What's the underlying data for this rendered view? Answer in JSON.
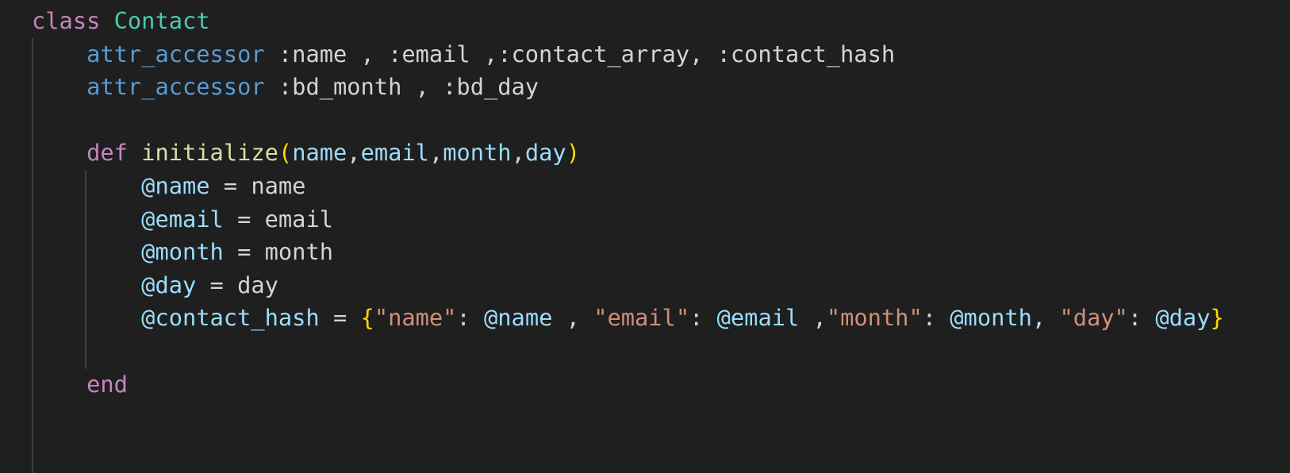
{
  "code_lines": [
    {
      "tokens": [
        {
          "t": "class",
          "c": "kw"
        },
        {
          "t": " ",
          "c": "plain"
        },
        {
          "t": "Contact",
          "c": "cls"
        }
      ]
    },
    {
      "tokens": [
        {
          "t": "    ",
          "c": "plain"
        },
        {
          "t": "attr_accessor",
          "c": "fn-blue"
        },
        {
          "t": " :name , :email ,:contact_array, :contact_hash",
          "c": "plain"
        }
      ]
    },
    {
      "tokens": [
        {
          "t": "    ",
          "c": "plain"
        },
        {
          "t": "attr_accessor",
          "c": "fn-blue"
        },
        {
          "t": " :bd_month , :bd_day",
          "c": "plain"
        }
      ]
    },
    {
      "tokens": []
    },
    {
      "tokens": [
        {
          "t": "    ",
          "c": "plain"
        },
        {
          "t": "def",
          "c": "kw"
        },
        {
          "t": " ",
          "c": "plain"
        },
        {
          "t": "initialize",
          "c": "fn-yellow"
        },
        {
          "t": "(",
          "c": "brace"
        },
        {
          "t": "name",
          "c": "var"
        },
        {
          "t": ",",
          "c": "plain"
        },
        {
          "t": "email",
          "c": "var"
        },
        {
          "t": ",",
          "c": "plain"
        },
        {
          "t": "month",
          "c": "var"
        },
        {
          "t": ",",
          "c": "plain"
        },
        {
          "t": "day",
          "c": "var"
        },
        {
          "t": ")",
          "c": "brace"
        }
      ]
    },
    {
      "tokens": [
        {
          "t": "        ",
          "c": "plain"
        },
        {
          "t": "@name",
          "c": "var"
        },
        {
          "t": " = name",
          "c": "plain"
        }
      ]
    },
    {
      "tokens": [
        {
          "t": "        ",
          "c": "plain"
        },
        {
          "t": "@email",
          "c": "var"
        },
        {
          "t": " = email",
          "c": "plain"
        }
      ]
    },
    {
      "tokens": [
        {
          "t": "        ",
          "c": "plain"
        },
        {
          "t": "@month",
          "c": "var"
        },
        {
          "t": " = month",
          "c": "plain"
        }
      ]
    },
    {
      "tokens": [
        {
          "t": "        ",
          "c": "plain"
        },
        {
          "t": "@day",
          "c": "var"
        },
        {
          "t": " = day",
          "c": "plain"
        }
      ]
    },
    {
      "tokens": [
        {
          "t": "        ",
          "c": "plain"
        },
        {
          "t": "@contact_hash",
          "c": "var"
        },
        {
          "t": " = ",
          "c": "plain"
        },
        {
          "t": "{",
          "c": "brace"
        },
        {
          "t": "\"name\"",
          "c": "str"
        },
        {
          "t": ": ",
          "c": "plain"
        },
        {
          "t": "@name",
          "c": "var"
        },
        {
          "t": " , ",
          "c": "plain"
        },
        {
          "t": "\"email\"",
          "c": "str"
        },
        {
          "t": ": ",
          "c": "plain"
        },
        {
          "t": "@email",
          "c": "var"
        },
        {
          "t": " ,",
          "c": "plain"
        },
        {
          "t": "\"month\"",
          "c": "str"
        },
        {
          "t": ": ",
          "c": "plain"
        },
        {
          "t": "@month",
          "c": "var"
        },
        {
          "t": ", ",
          "c": "plain"
        },
        {
          "t": "\"day\"",
          "c": "str"
        },
        {
          "t": ": ",
          "c": "plain"
        },
        {
          "t": "@day",
          "c": "var"
        },
        {
          "t": "}",
          "c": "brace"
        }
      ]
    },
    {
      "tokens": []
    },
    {
      "tokens": [
        {
          "t": "    ",
          "c": "plain"
        },
        {
          "t": "end",
          "c": "kw"
        }
      ]
    }
  ]
}
